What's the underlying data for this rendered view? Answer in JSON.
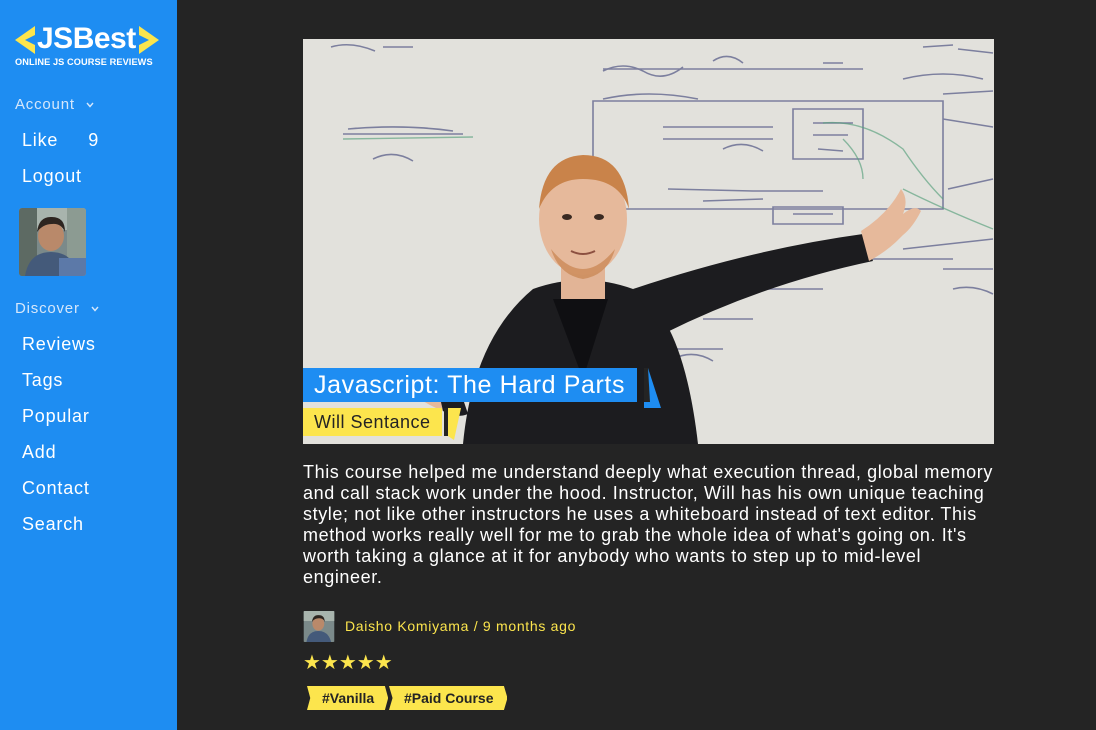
{
  "brand": {
    "name": "JSBest",
    "tagline": "ONLINE JS COURSE REVIEWS",
    "accent": "#1e8df2",
    "highlight": "#fce54d"
  },
  "sidebar": {
    "account_section": "Account",
    "like_label": "Like",
    "like_count": "9",
    "logout_label": "Logout",
    "discover_section": "Discover",
    "items": [
      {
        "label": "Reviews"
      },
      {
        "label": "Tags"
      },
      {
        "label": "Popular"
      },
      {
        "label": "Add"
      },
      {
        "label": "Contact"
      },
      {
        "label": "Search"
      }
    ]
  },
  "course": {
    "title": "Javascript: The Hard Parts",
    "author": "Will Sentance",
    "review": "This course helped me understand deeply what execution thread, global memory and call stack work under the hood. Instructor, Will has his own unique teaching style; not like other instructors he uses a whiteboard instead of text editor. This method works really well for me to grab the whole idea of what's going on. It's worth taking a glance at it for anybody who wants to step up to mid-level engineer.",
    "reviewer": "Daisho Komiyama",
    "separator": "/",
    "posted": "9 months ago",
    "stars": "★★★★★",
    "rating": 5,
    "tags": [
      "#Vanilla",
      "#Paid Course"
    ]
  }
}
